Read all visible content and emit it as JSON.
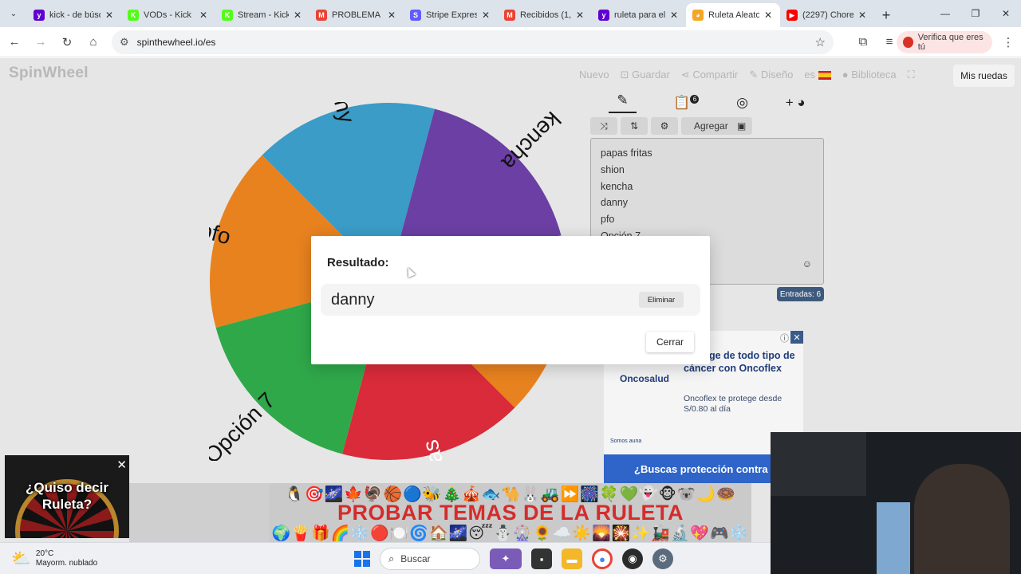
{
  "browser": {
    "tabs": [
      {
        "title": "kick - de búsqueda",
        "color": "#6001d2",
        "glyph": "y",
        "active": false
      },
      {
        "title": "VODs - Kick I",
        "color": "#53fc18",
        "glyph": "K",
        "active": false
      },
      {
        "title": "Stream - Kick",
        "color": "#53fc18",
        "glyph": "K",
        "active": false
      },
      {
        "title": "PROBLEMA C",
        "color": "#ea4335",
        "glyph": "M",
        "active": false
      },
      {
        "title": "Stripe Expres",
        "color": "#635bff",
        "glyph": "S",
        "active": false
      },
      {
        "title": "Recibidos (1,",
        "color": "#ea4335",
        "glyph": "M",
        "active": false
      },
      {
        "title": "ruleta para el",
        "color": "#6001d2",
        "glyph": "y",
        "active": false
      },
      {
        "title": "Ruleta Aleato",
        "color": "#f5a623",
        "glyph": "◕",
        "active": true
      },
      {
        "title": "(2297) Chore",
        "color": "#ff0000",
        "glyph": "▶",
        "active": false
      }
    ],
    "url": "spinthewheel.io/es",
    "verify_label": "Verifica que eres tú"
  },
  "site": {
    "logo": "SpinWheel",
    "nav": [
      "Nuevo",
      "Guardar",
      "Compartir",
      "Diseño",
      "es",
      "Biblioteca"
    ],
    "my_wheels": "Mis ruedas",
    "add_label": "Agregar",
    "entries_badge": "6",
    "entries": [
      "papas fritas",
      "shion",
      "kencha",
      "danny",
      "pfo",
      "Opción 7"
    ],
    "entries_count": "Entradas: 6"
  },
  "wheel": {
    "segments": [
      {
        "label": "pfo",
        "color": "#e8821f"
      },
      {
        "label": "danny",
        "color": "#3a9cc7"
      },
      {
        "label": "kencha",
        "color": "#6b3fa3"
      },
      {
        "label": "shion",
        "color": "#e8821f"
      },
      {
        "label": "papas fritas",
        "color": "#d92b3a"
      },
      {
        "label": "Opción 7",
        "color": "#2fa84a"
      }
    ]
  },
  "dialog": {
    "title": "Resultado:",
    "result": "danny",
    "delete_label": "Eliminar",
    "close_label": "Cerrar"
  },
  "ads": {
    "onco_headline": "Protege de todo tipo de cáncer con Oncoflex",
    "onco_brand": "Oncosalud",
    "onco_sub": "Oncoflex te protege desde S/0.80 al día",
    "onco_small": "Somos auna",
    "onco_bar": "¿Buscas protección contra",
    "quiso_text": "¿Quiso decir Ruleta?",
    "temas_title": "PROBAR TEMAS DE LA RULETA",
    "temas_emoji_top": "🐧🎯🌌🍁🦃🏀🔵🐝🎄🎪🐟🐪🐰🚜⏩🎆🍀💚👻🐵🐨🌙🍩",
    "temas_emoji_bottom": "🌍🍟🎁🌈❄️🔴🍽️🌀🏠🌌😴⛄🎡🌻☁️☀️🌄🎇✨🚂🔬💖🎮❄️"
  },
  "taskbar": {
    "temp": "20°C",
    "weather": "Mayorm. nublado",
    "search": "Buscar"
  }
}
